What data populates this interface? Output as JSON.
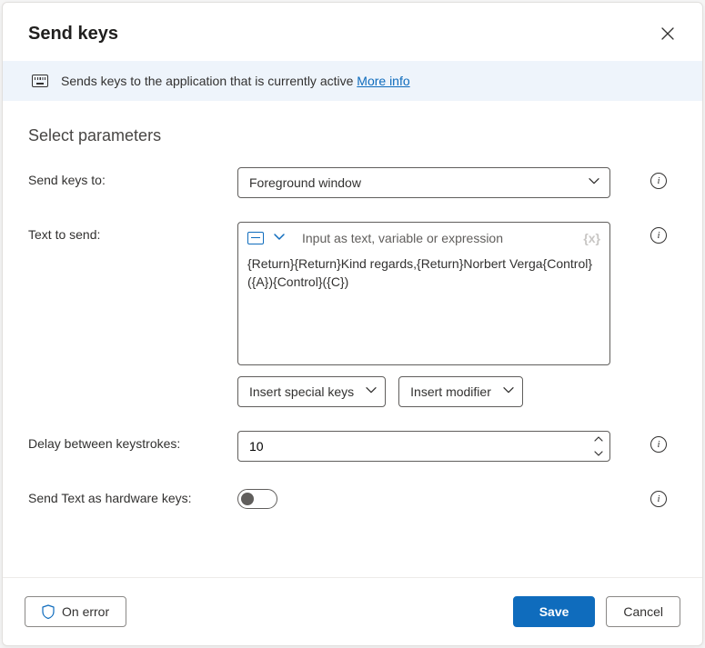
{
  "header": {
    "title": "Send keys"
  },
  "infobar": {
    "text": "Sends keys to the application that is currently active ",
    "link": "More info"
  },
  "section_title": "Select parameters",
  "fields": {
    "send_keys_to": {
      "label": "Send keys to:",
      "value": "Foreground window"
    },
    "text_to_send": {
      "label": "Text to send:",
      "placeholder": "Input as text, variable or expression",
      "value": "{Return}{Return}Kind regards,{Return}Norbert Verga{Control}({A}){Control}({C})",
      "insert_special": "Insert special keys",
      "insert_modifier": "Insert modifier"
    },
    "delay": {
      "label": "Delay between keystrokes:",
      "value": "10"
    },
    "hardware": {
      "label": "Send Text as hardware keys:",
      "value": false
    }
  },
  "footer": {
    "on_error": "On error",
    "save": "Save",
    "cancel": "Cancel"
  }
}
